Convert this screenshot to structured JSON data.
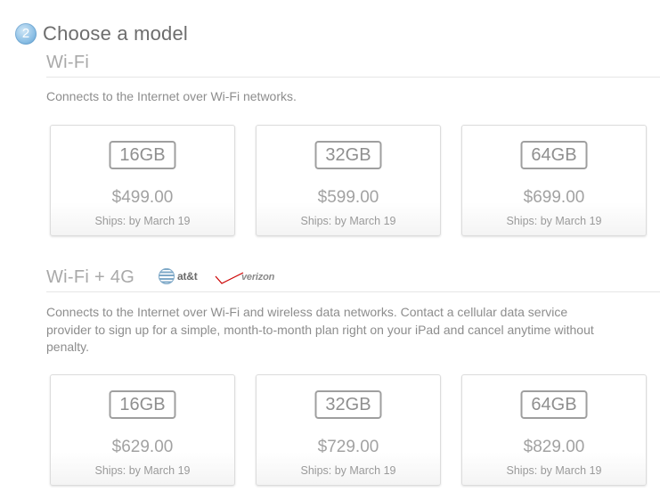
{
  "step": {
    "number": "2",
    "title": "Choose a model"
  },
  "sections": [
    {
      "title": "Wi-Fi",
      "description": "Connects to the Internet over Wi-Fi networks.",
      "models": [
        {
          "capacity": "16GB",
          "price": "$499.00",
          "ships": "Ships: by March 19"
        },
        {
          "capacity": "32GB",
          "price": "$599.00",
          "ships": "Ships: by March 19"
        },
        {
          "capacity": "64GB",
          "price": "$699.00",
          "ships": "Ships: by March 19"
        }
      ]
    },
    {
      "title": "Wi-Fi + 4G",
      "carriers": [
        {
          "name": "at&t",
          "icon": "att-globe-logo"
        },
        {
          "name": "verizon",
          "icon": "verizon-check-logo"
        }
      ],
      "description_lines": [
        "Connects to the Internet over Wi-Fi and wireless data networks. Contact a cellular data service",
        "provider to sign up for a simple, month-to-month plan right on your iPad and cancel anytime without",
        "penalty."
      ],
      "models": [
        {
          "capacity": "16GB",
          "price": "$629.00",
          "ships": "Ships: by March 19"
        },
        {
          "capacity": "32GB",
          "price": "$729.00",
          "ships": "Ships: by March 19"
        },
        {
          "capacity": "64GB",
          "price": "$829.00",
          "ships": "Ships: by March 19"
        }
      ]
    }
  ],
  "colors": {
    "step_badge": "#8fc1e6",
    "verizon_check": "#cc0000"
  }
}
